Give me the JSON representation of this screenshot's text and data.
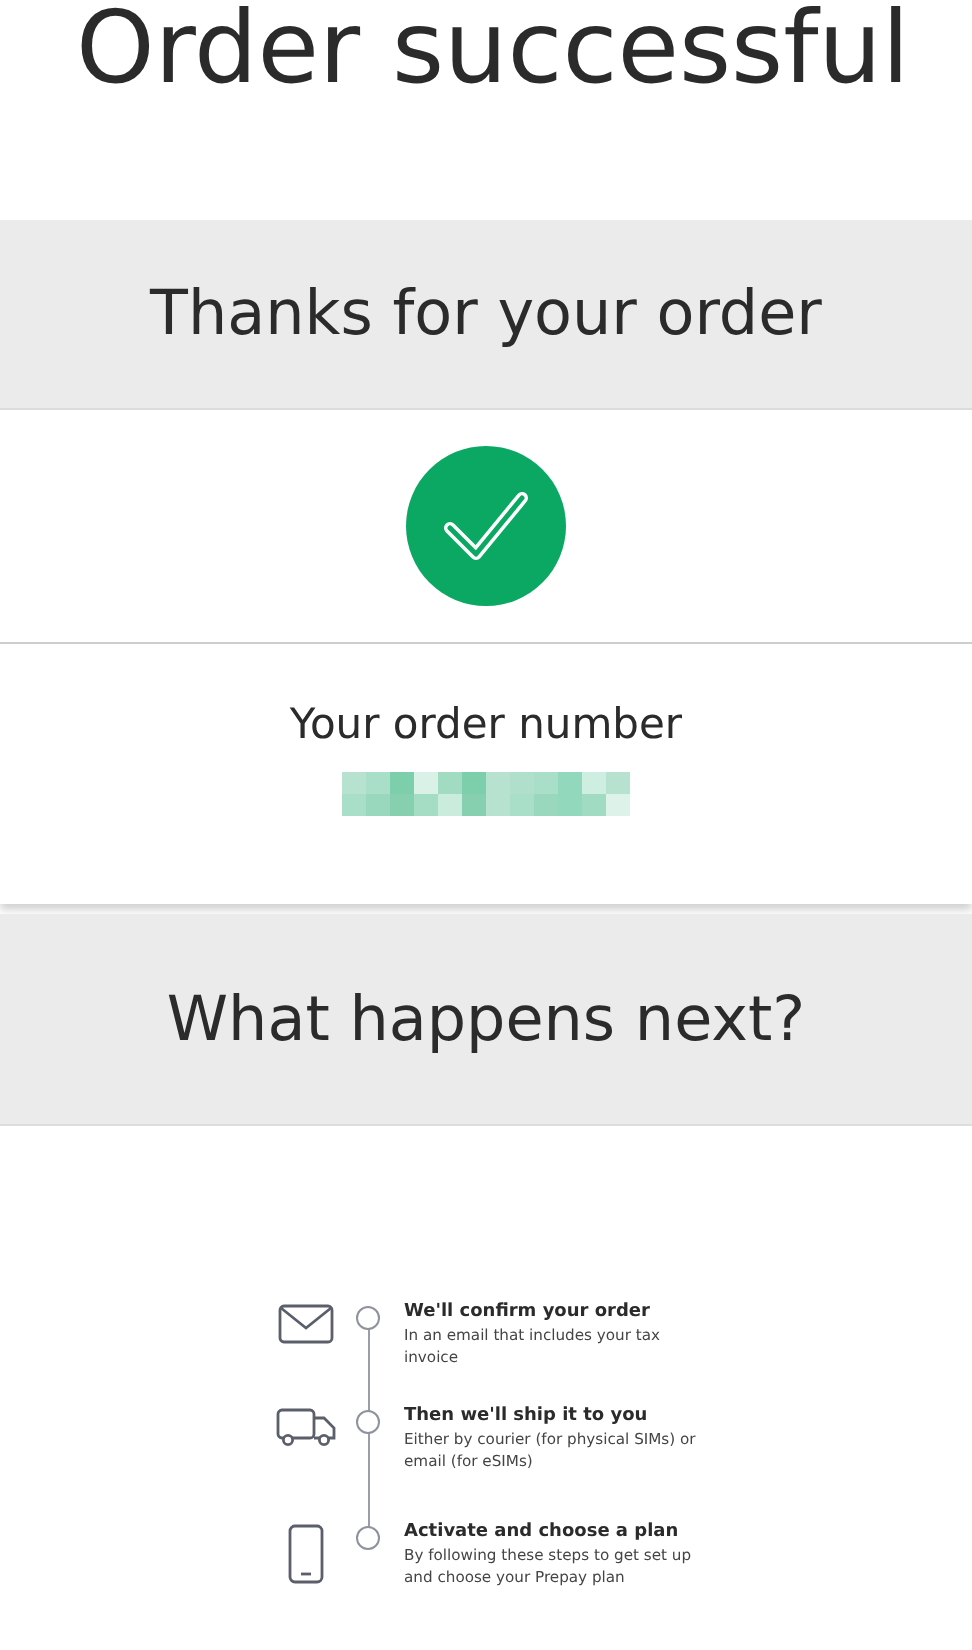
{
  "page_title": "Order successful",
  "confirmation": {
    "heading": "Thanks for your order",
    "order_number_label": "Your order number"
  },
  "next": {
    "heading": "What happens next?",
    "steps": [
      {
        "kind": "email",
        "title": "We'll confirm your order",
        "description": "In an email that includes your tax invoice"
      },
      {
        "kind": "truck",
        "title": "Then we'll ship it to you",
        "description": "Either by courier (for physical SIMs) or email (for eSIMs)"
      },
      {
        "kind": "phone",
        "title": "Activate and choose a plan",
        "description": "By following these steps to get set up and choose your Prepay plan"
      }
    ]
  }
}
